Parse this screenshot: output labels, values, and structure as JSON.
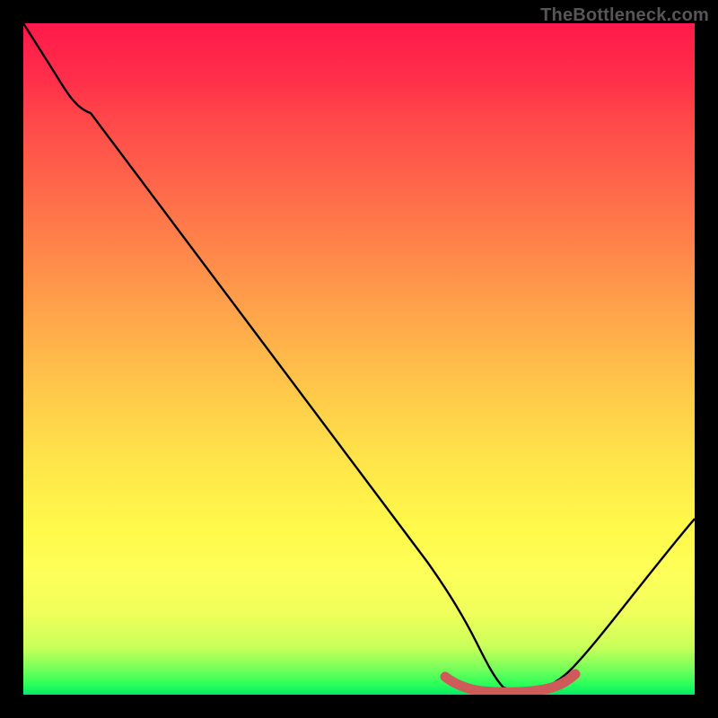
{
  "watermark": "TheBottleneck.com",
  "chart_data": {
    "type": "line",
    "title": "",
    "xlabel": "",
    "ylabel": "",
    "xlim": [
      0,
      100
    ],
    "ylim": [
      0,
      100
    ],
    "grid": false,
    "series": [
      {
        "name": "bottleneck-curve",
        "x": [
          0,
          5,
          10,
          20,
          30,
          40,
          50,
          58,
          63,
          70,
          74,
          78,
          88,
          100
        ],
        "y": [
          100,
          92,
          87,
          74,
          61,
          48,
          34,
          21,
          10,
          1,
          0.5,
          1,
          10,
          26
        ],
        "color": "#000000"
      },
      {
        "name": "flat-zone-highlight",
        "x": [
          63,
          65,
          68,
          71,
          74,
          77,
          80,
          82
        ],
        "y": [
          2.2,
          1.2,
          0.8,
          0.6,
          0.6,
          0.8,
          1.3,
          2.6
        ],
        "color": "#cf5a5a"
      }
    ],
    "gradient_stops": [
      {
        "pos": 0,
        "color": "#ff1a4a"
      },
      {
        "pos": 50,
        "color": "#ffc94a"
      },
      {
        "pos": 85,
        "color": "#fcff54"
      },
      {
        "pos": 100,
        "color": "#00e96c"
      }
    ]
  }
}
